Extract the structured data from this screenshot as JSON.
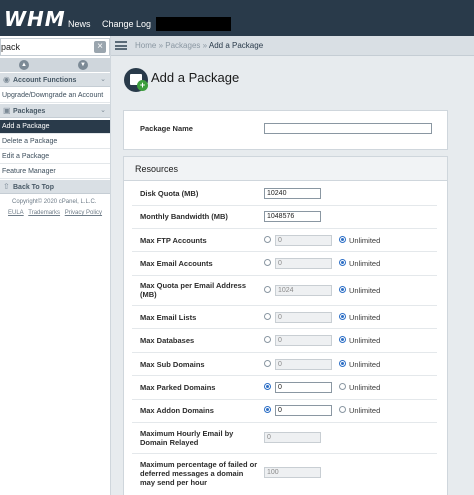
{
  "header": {
    "logo": "WHM",
    "nav": [
      "News",
      "Change Log"
    ]
  },
  "sidebar": {
    "search_value": "pack",
    "clear_icon": "×",
    "categories": [
      {
        "label": "Account Functions"
      },
      {
        "label": "Packages"
      }
    ],
    "account_items": [
      "Upgrade/Downgrade an Account"
    ],
    "package_items": [
      "Add a Package",
      "Delete a Package",
      "Edit a Package",
      "Feature Manager"
    ],
    "back_to_top": "Back To Top",
    "copyright": "Copyright© 2020 cPanel, L.L.C.",
    "links": [
      "EULA",
      "Trademarks",
      "Privacy Policy"
    ]
  },
  "breadcrumb": {
    "items": [
      "Home",
      "Packages"
    ],
    "separator": "»",
    "current": "Add a Package"
  },
  "page": {
    "title": "Add a Package"
  },
  "package_name": {
    "label": "Package Name",
    "value": ""
  },
  "resources": {
    "title": "Resources",
    "disk_quota": {
      "label": "Disk Quota (MB)",
      "value": "10240"
    },
    "bandwidth": {
      "label": "Monthly Bandwidth (MB)",
      "value": "1048576"
    },
    "rows": [
      {
        "label": "Max FTP Accounts",
        "value": "0",
        "unlimited": true
      },
      {
        "label": "Max Email Accounts",
        "value": "0",
        "unlimited": true
      },
      {
        "label": "Max Quota per Email Address (MB)",
        "value": "1024",
        "unlimited": true
      },
      {
        "label": "Max Email Lists",
        "value": "0",
        "unlimited": true
      },
      {
        "label": "Max Databases",
        "value": "0",
        "unlimited": true
      },
      {
        "label": "Max Sub Domains",
        "value": "0",
        "unlimited": true
      },
      {
        "label": "Max Parked Domains",
        "value": "0",
        "unlimited": false
      },
      {
        "label": "Max Addon Domains",
        "value": "0",
        "unlimited": false
      }
    ],
    "unlimited_label": "Unlimited",
    "hourly_email": {
      "label": "Maximum Hourly Email by Domain Relayed",
      "value": "0"
    },
    "failed_pct": {
      "label": "Maximum percentage of failed or deferred messages a domain may send per hour",
      "value": "100"
    }
  }
}
